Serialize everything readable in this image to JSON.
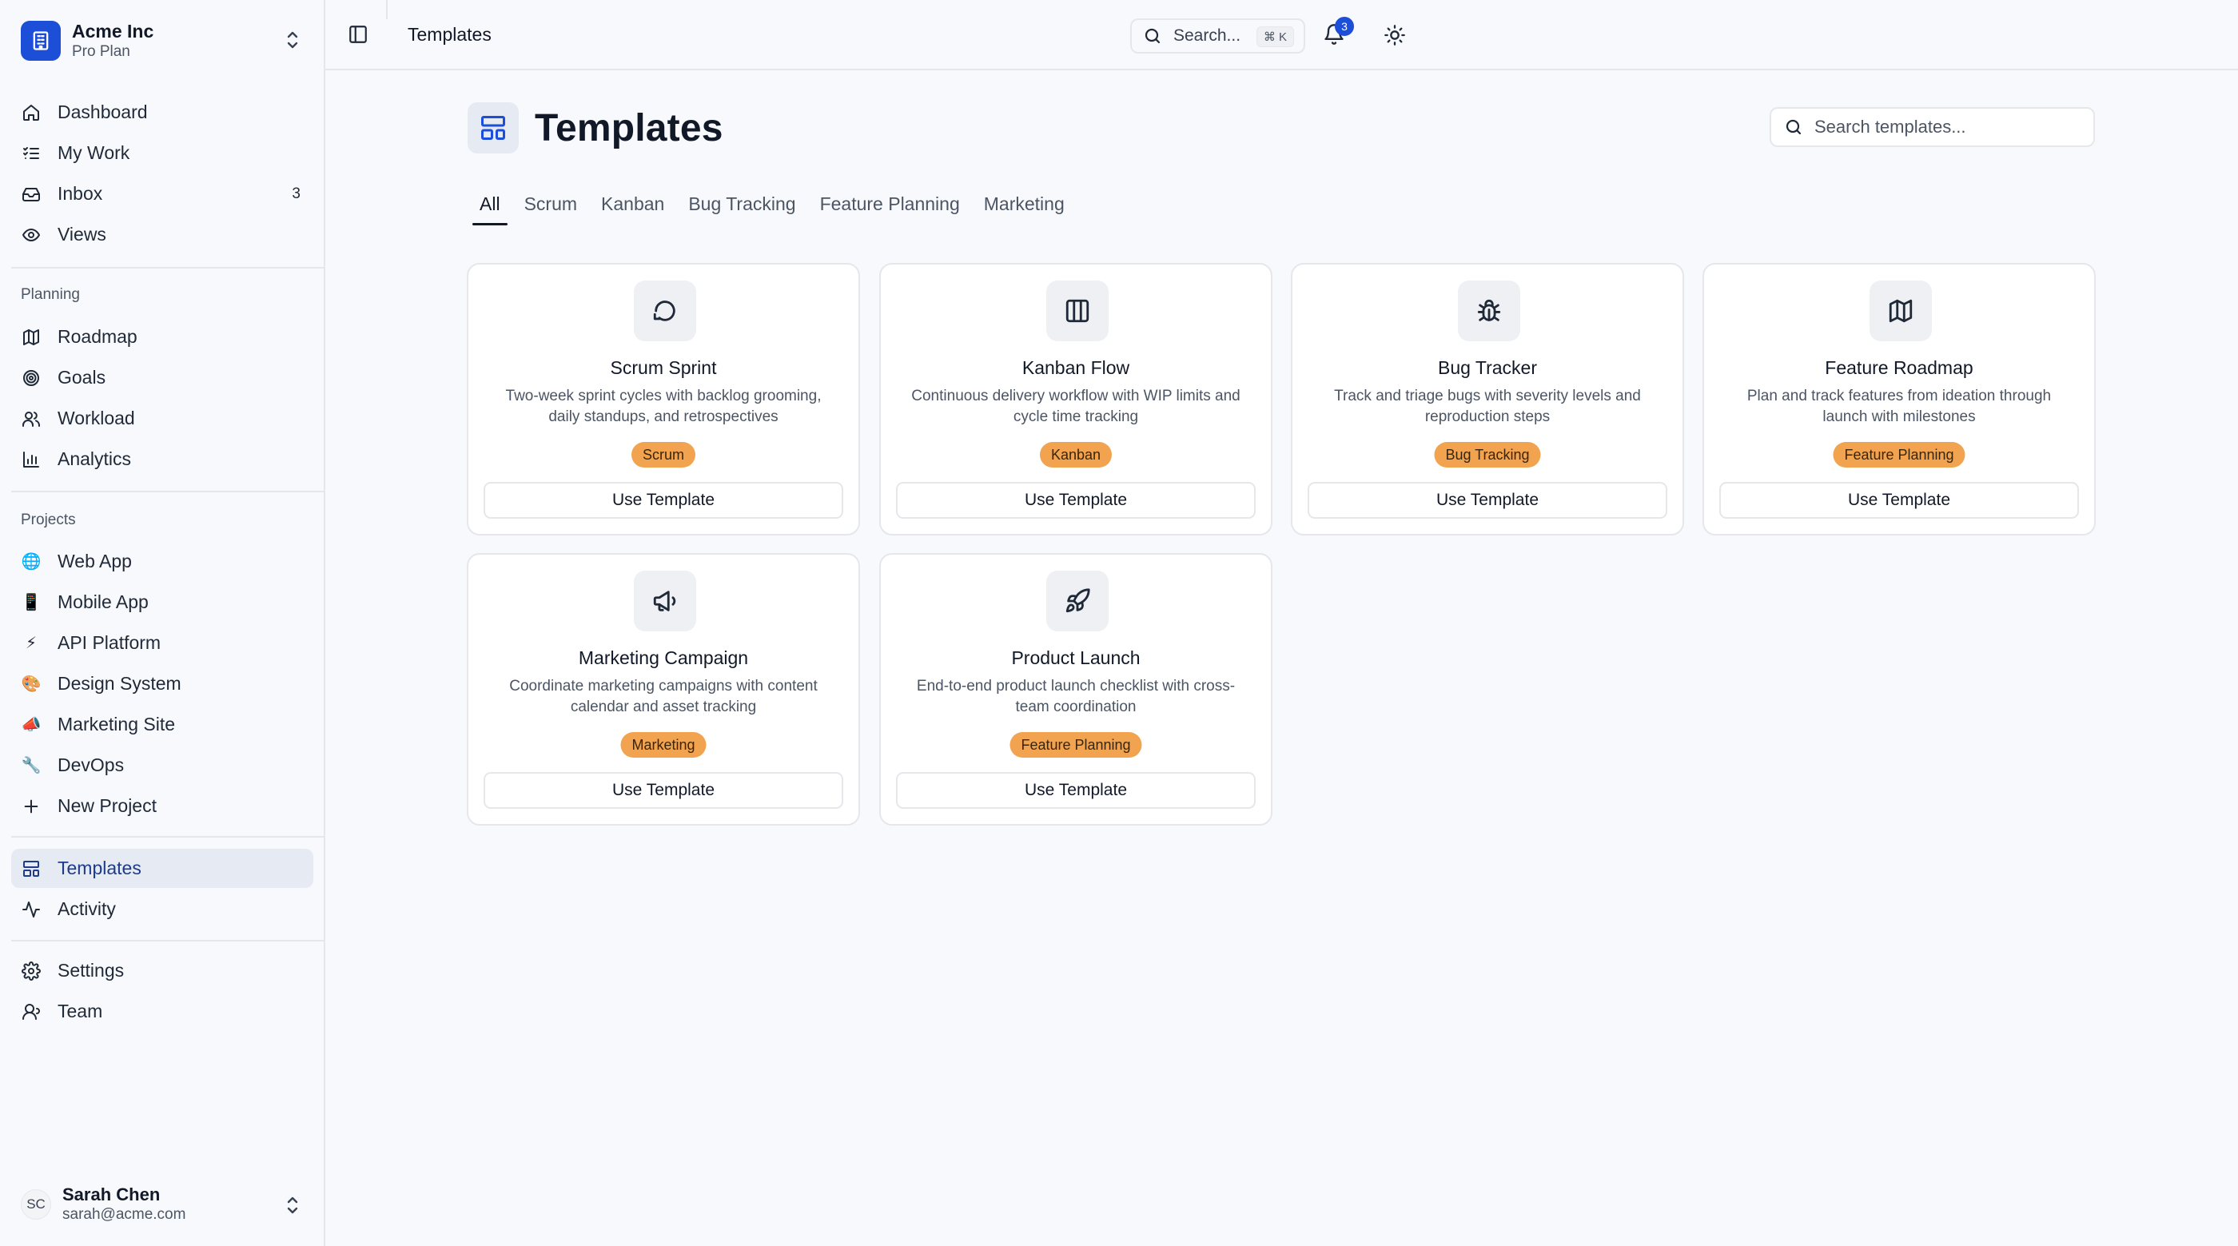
{
  "org": {
    "name": "Acme Inc",
    "plan": "Pro Plan"
  },
  "nav_main": [
    {
      "label": "Dashboard",
      "icon": "home-icon"
    },
    {
      "label": "My Work",
      "icon": "list-check-icon"
    },
    {
      "label": "Inbox",
      "icon": "inbox-icon",
      "badge": "3"
    },
    {
      "label": "Views",
      "icon": "eye-icon"
    }
  ],
  "planning": {
    "label": "Planning",
    "items": [
      {
        "label": "Roadmap",
        "icon": "map-icon"
      },
      {
        "label": "Goals",
        "icon": "target-icon"
      },
      {
        "label": "Workload",
        "icon": "users-icon"
      },
      {
        "label": "Analytics",
        "icon": "bar-chart-icon"
      }
    ]
  },
  "projects": {
    "label": "Projects",
    "items": [
      {
        "label": "Web App",
        "emoji": "🌐"
      },
      {
        "label": "Mobile App",
        "emoji": "📱"
      },
      {
        "label": "API Platform",
        "emoji": "⚡"
      },
      {
        "label": "Design System",
        "emoji": "🎨"
      },
      {
        "label": "Marketing Site",
        "emoji": "📣"
      },
      {
        "label": "DevOps",
        "emoji": "🔧"
      }
    ],
    "new_label": "New Project"
  },
  "nav_bottom": [
    {
      "label": "Templates",
      "icon": "layout-template-icon",
      "active": true
    },
    {
      "label": "Activity",
      "icon": "activity-icon"
    }
  ],
  "nav_settings": [
    {
      "label": "Settings",
      "icon": "gear-icon"
    },
    {
      "label": "Team",
      "icon": "user-icon"
    }
  ],
  "user": {
    "initials": "SC",
    "name": "Sarah Chen",
    "email": "sarah@acme.com"
  },
  "topbar": {
    "breadcrumb": "Templates",
    "search_label": "Search...",
    "shortcut": "⌘ K",
    "notification_count": "3"
  },
  "page": {
    "title": "Templates",
    "search_placeholder": "Search templates..."
  },
  "tabs": [
    {
      "label": "All",
      "active": true
    },
    {
      "label": "Scrum"
    },
    {
      "label": "Kanban"
    },
    {
      "label": "Bug Tracking"
    },
    {
      "label": "Feature Planning"
    },
    {
      "label": "Marketing"
    }
  ],
  "templates": [
    {
      "title": "Scrum Sprint",
      "description": "Two-week sprint cycles with backlog grooming, daily standups, and retrospectives",
      "tag": "Scrum",
      "icon": "refresh-icon",
      "button": "Use Template"
    },
    {
      "title": "Kanban Flow",
      "description": "Continuous delivery workflow with WIP limits and cycle time tracking",
      "tag": "Kanban",
      "icon": "columns-icon",
      "button": "Use Template"
    },
    {
      "title": "Bug Tracker",
      "description": "Track and triage bugs with severity levels and reproduction steps",
      "tag": "Bug Tracking",
      "icon": "bug-icon",
      "button": "Use Template"
    },
    {
      "title": "Feature Roadmap",
      "description": "Plan and track features from ideation through launch with milestones",
      "tag": "Feature Planning",
      "icon": "map-icon",
      "button": "Use Template"
    },
    {
      "title": "Marketing Campaign",
      "description": "Coordinate marketing campaigns with content calendar and asset tracking",
      "tag": "Marketing",
      "icon": "megaphone-icon",
      "button": "Use Template"
    },
    {
      "title": "Product Launch",
      "description": "End-to-end product launch checklist with cross-team coordination",
      "tag": "Feature Planning",
      "icon": "rocket-icon",
      "button": "Use Template"
    }
  ]
}
